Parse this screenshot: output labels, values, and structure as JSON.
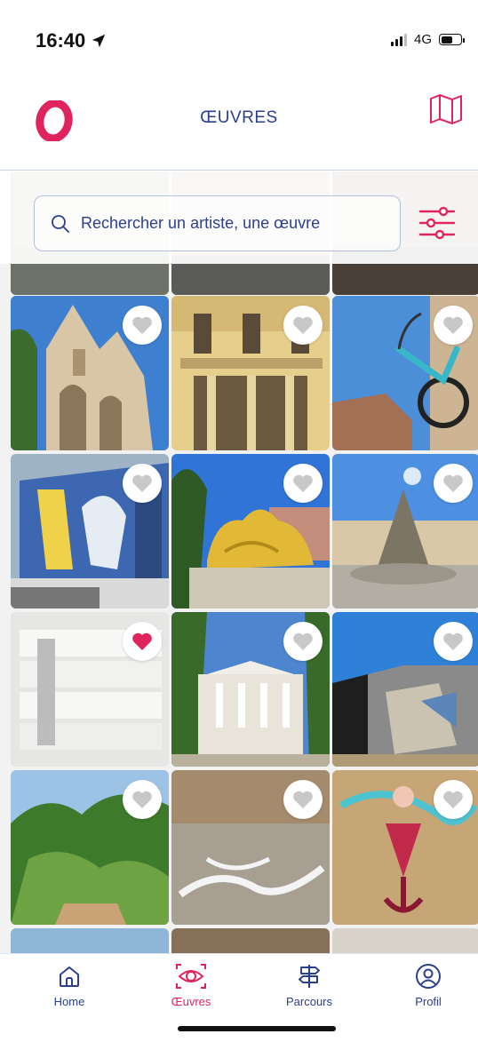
{
  "status_bar": {
    "time": "16:40",
    "network": "4G"
  },
  "header": {
    "title": "ŒUVRES",
    "logo_glyph": "O"
  },
  "search": {
    "placeholder": "Rechercher un artiste, une œuvre"
  },
  "colors": {
    "primary": "#2b3f8f",
    "accent": "#e0245e",
    "favorite_active": "#e0245e",
    "favorite_inactive": "#c8c8c8"
  },
  "artworks": [
    {
      "scene": "cathedral",
      "favorite": false
    },
    {
      "scene": "theatre",
      "favorite": false
    },
    {
      "scene": "bicycle",
      "favorite": false
    },
    {
      "scene": "mural-wall",
      "favorite": false
    },
    {
      "scene": "golden-sculpture",
      "favorite": false
    },
    {
      "scene": "fountain-plaza",
      "favorite": false
    },
    {
      "scene": "white-building",
      "favorite": true
    },
    {
      "scene": "classical-facade",
      "favorite": false
    },
    {
      "scene": "street-art-facade",
      "favorite": false
    },
    {
      "scene": "garden",
      "favorite": false
    },
    {
      "scene": "plaza-ground-art",
      "favorite": false
    },
    {
      "scene": "anchor-mural",
      "favorite": false
    }
  ],
  "tabs": [
    {
      "id": "home",
      "label": "Home",
      "icon": "home-icon",
      "active": false
    },
    {
      "id": "oeuvres",
      "label": "Œuvres",
      "icon": "eye-icon",
      "active": true
    },
    {
      "id": "parcours",
      "label": "Parcours",
      "icon": "signpost-icon",
      "active": false
    },
    {
      "id": "profil",
      "label": "Profil",
      "icon": "user-icon",
      "active": false
    }
  ]
}
